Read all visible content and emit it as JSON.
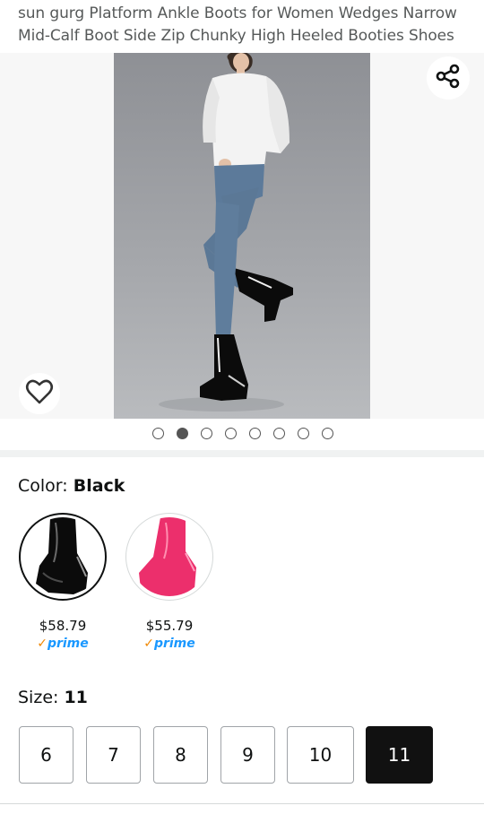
{
  "product": {
    "title": "sun gurg Platform Ankle Boots for Women Wedges Narrow Mid-Calf Boot Side Zip Chunky High Heeled Booties Shoes"
  },
  "gallery": {
    "share_icon": "share-icon",
    "wishlist_icon": "heart-icon",
    "dot_count": 8,
    "active_dot_index": 1
  },
  "color": {
    "label": "Color: ",
    "selected": "Black",
    "options": [
      {
        "name": "Black",
        "price": "$58.79",
        "prime": "prime",
        "swatch_color": "#111111",
        "selected": true
      },
      {
        "name": "Pink",
        "price": "$55.79",
        "prime": "prime",
        "swatch_color": "#ec2f6c",
        "selected": false
      }
    ]
  },
  "size": {
    "label": "Size: ",
    "selected": "11",
    "options": [
      "6",
      "7",
      "8",
      "9",
      "10",
      "11"
    ]
  },
  "colors": {
    "text_dark": "#0f1111",
    "text_muted": "#565959",
    "prime_blue": "#1a98ff",
    "prime_check": "#f08804",
    "selected_size_bg": "#111111"
  }
}
